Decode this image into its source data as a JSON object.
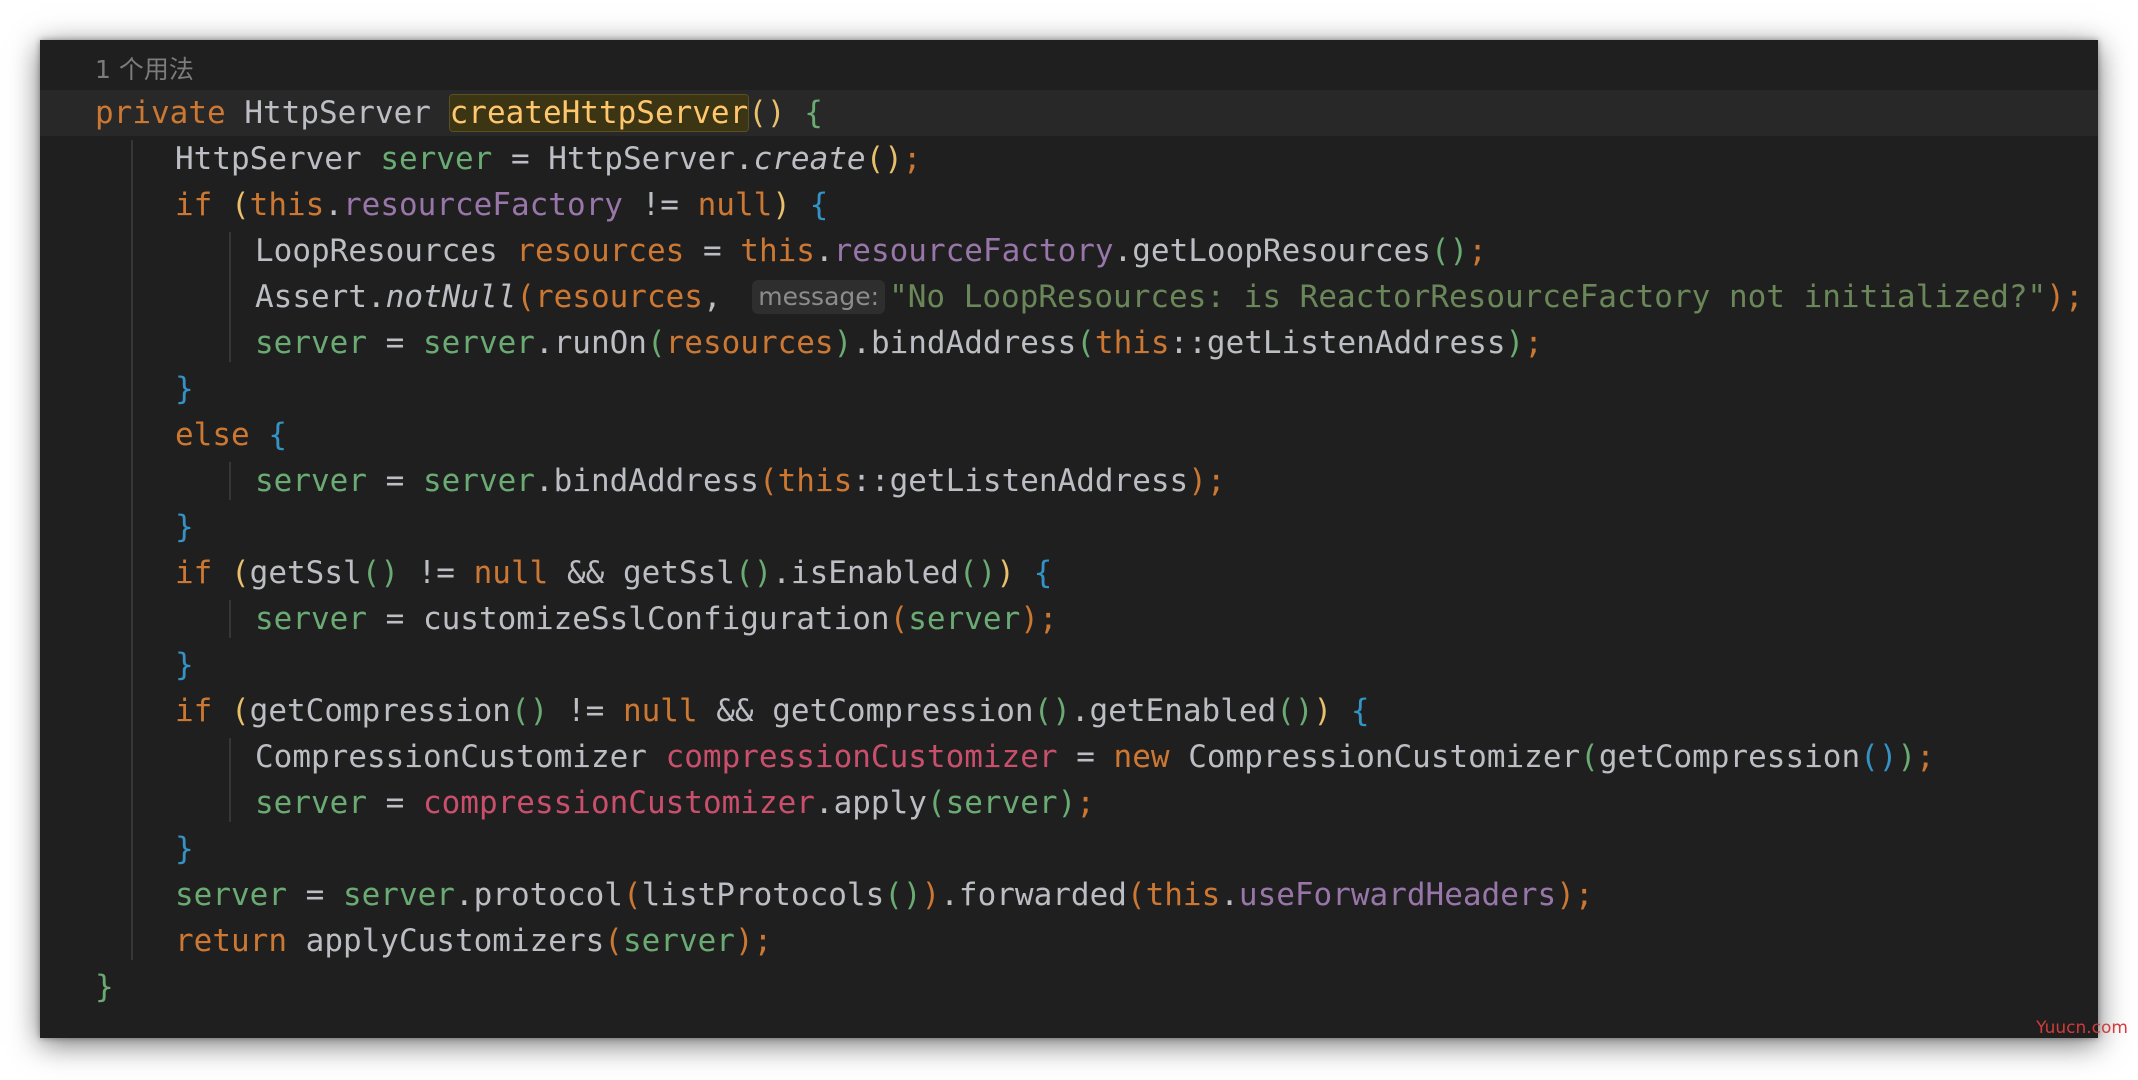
{
  "editor": {
    "usage_hint": "1 个用法",
    "lines": [
      {
        "indent": 0,
        "current": true,
        "tokens": [
          {
            "t": "private",
            "c": "#cc7832"
          },
          {
            "t": " ",
            "c": "#bcbec4"
          },
          {
            "t": "HttpServer",
            "c": "#bcbec4"
          },
          {
            "t": " ",
            "c": "#bcbec4"
          },
          {
            "t": "createHttpServer",
            "c": "#ffc66d",
            "hl": true
          },
          {
            "t": "()",
            "c": "#e8bf6a"
          },
          {
            "t": " ",
            "c": "#bcbec4"
          },
          {
            "t": "{",
            "c": "#6aab73"
          }
        ]
      },
      {
        "indent": 1,
        "tokens": [
          {
            "t": "HttpServer",
            "c": "#bcbec4"
          },
          {
            "t": " ",
            "c": "#bcbec4"
          },
          {
            "t": "server",
            "c": "#6aab73"
          },
          {
            "t": " = ",
            "c": "#bcbec4"
          },
          {
            "t": "HttpServer.",
            "c": "#bcbec4"
          },
          {
            "t": "create",
            "c": "#bcbec4",
            "i": true
          },
          {
            "t": "()",
            "c": "#e8bf6a"
          },
          {
            "t": ";",
            "c": "#cc7832"
          }
        ]
      },
      {
        "indent": 1,
        "tokens": [
          {
            "t": "if",
            "c": "#cc7832"
          },
          {
            "t": " ",
            "c": "#bcbec4"
          },
          {
            "t": "(",
            "c": "#e8bf6a"
          },
          {
            "t": "this",
            "c": "#cc7832"
          },
          {
            "t": ".",
            "c": "#bcbec4"
          },
          {
            "t": "resourceFactory",
            "c": "#9876aa"
          },
          {
            "t": " != ",
            "c": "#bcbec4"
          },
          {
            "t": "null",
            "c": "#cc7832"
          },
          {
            "t": ")",
            "c": "#e8bf6a"
          },
          {
            "t": " ",
            "c": "#bcbec4"
          },
          {
            "t": "{",
            "c": "#3592c4"
          }
        ]
      },
      {
        "indent": 2,
        "tokens": [
          {
            "t": "LoopResources",
            "c": "#bcbec4"
          },
          {
            "t": " ",
            "c": "#bcbec4"
          },
          {
            "t": "resources",
            "c": "#cc7832"
          },
          {
            "t": " = ",
            "c": "#bcbec4"
          },
          {
            "t": "this",
            "c": "#cc7832"
          },
          {
            "t": ".",
            "c": "#bcbec4"
          },
          {
            "t": "resourceFactory",
            "c": "#9876aa"
          },
          {
            "t": ".getLoopResources",
            "c": "#bcbec4"
          },
          {
            "t": "()",
            "c": "#6aab73"
          },
          {
            "t": ";",
            "c": "#cc7832"
          }
        ]
      },
      {
        "indent": 2,
        "tokens": [
          {
            "t": "Assert.",
            "c": "#bcbec4"
          },
          {
            "t": "notNull",
            "c": "#bcbec4",
            "i": true
          },
          {
            "t": "(",
            "c": "#cc7832"
          },
          {
            "t": "resources",
            "c": "#cc7832"
          },
          {
            "t": ", ",
            "c": "#bcbec4"
          },
          {
            "t": "message:",
            "inlay": true
          },
          {
            "t": "\"No LoopResources: is ReactorResourceFactory not initialized?\"",
            "c": "#6a8759"
          },
          {
            "t": ")",
            "c": "#cc7832"
          },
          {
            "t": ";",
            "c": "#cc7832"
          }
        ]
      },
      {
        "indent": 2,
        "tokens": [
          {
            "t": "server",
            "c": "#6aab73"
          },
          {
            "t": " = ",
            "c": "#bcbec4"
          },
          {
            "t": "server",
            "c": "#6aab73"
          },
          {
            "t": ".runOn",
            "c": "#bcbec4"
          },
          {
            "t": "(",
            "c": "#6aab73"
          },
          {
            "t": "resources",
            "c": "#cc7832"
          },
          {
            "t": ")",
            "c": "#6aab73"
          },
          {
            "t": ".bindAddress",
            "c": "#bcbec4"
          },
          {
            "t": "(",
            "c": "#6aab73"
          },
          {
            "t": "this",
            "c": "#cc7832"
          },
          {
            "t": "::getListenAddress",
            "c": "#bcbec4"
          },
          {
            "t": ")",
            "c": "#6aab73"
          },
          {
            "t": ";",
            "c": "#cc7832"
          }
        ]
      },
      {
        "indent": 1,
        "tokens": [
          {
            "t": "}",
            "c": "#3592c4"
          }
        ]
      },
      {
        "indent": 1,
        "tokens": [
          {
            "t": "else",
            "c": "#cc7832"
          },
          {
            "t": " ",
            "c": "#bcbec4"
          },
          {
            "t": "{",
            "c": "#3592c4"
          }
        ]
      },
      {
        "indent": 2,
        "tokens": [
          {
            "t": "server",
            "c": "#6aab73"
          },
          {
            "t": " = ",
            "c": "#bcbec4"
          },
          {
            "t": "server",
            "c": "#6aab73"
          },
          {
            "t": ".bindAddress",
            "c": "#bcbec4"
          },
          {
            "t": "(",
            "c": "#cc7832"
          },
          {
            "t": "this",
            "c": "#cc7832"
          },
          {
            "t": "::getListenAddress",
            "c": "#bcbec4"
          },
          {
            "t": ")",
            "c": "#cc7832"
          },
          {
            "t": ";",
            "c": "#cc7832"
          }
        ]
      },
      {
        "indent": 1,
        "tokens": [
          {
            "t": "}",
            "c": "#3592c4"
          }
        ]
      },
      {
        "indent": 1,
        "tokens": [
          {
            "t": "if",
            "c": "#cc7832"
          },
          {
            "t": " ",
            "c": "#bcbec4"
          },
          {
            "t": "(",
            "c": "#e8bf6a"
          },
          {
            "t": "getSsl",
            "c": "#bcbec4"
          },
          {
            "t": "()",
            "c": "#6aab73"
          },
          {
            "t": " != ",
            "c": "#bcbec4"
          },
          {
            "t": "null",
            "c": "#cc7832"
          },
          {
            "t": " && ",
            "c": "#bcbec4"
          },
          {
            "t": "getSsl",
            "c": "#bcbec4"
          },
          {
            "t": "()",
            "c": "#6aab73"
          },
          {
            "t": ".isEnabled",
            "c": "#bcbec4"
          },
          {
            "t": "()",
            "c": "#6aab73"
          },
          {
            "t": ")",
            "c": "#e8bf6a"
          },
          {
            "t": " ",
            "c": "#bcbec4"
          },
          {
            "t": "{",
            "c": "#3592c4"
          }
        ]
      },
      {
        "indent": 2,
        "tokens": [
          {
            "t": "server",
            "c": "#6aab73"
          },
          {
            "t": " = ",
            "c": "#bcbec4"
          },
          {
            "t": "customizeSslConfiguration",
            "c": "#bcbec4"
          },
          {
            "t": "(",
            "c": "#cc7832"
          },
          {
            "t": "server",
            "c": "#6aab73"
          },
          {
            "t": ")",
            "c": "#cc7832"
          },
          {
            "t": ";",
            "c": "#cc7832"
          }
        ]
      },
      {
        "indent": 1,
        "tokens": [
          {
            "t": "}",
            "c": "#3592c4"
          }
        ]
      },
      {
        "indent": 1,
        "tokens": [
          {
            "t": "if",
            "c": "#cc7832"
          },
          {
            "t": " ",
            "c": "#bcbec4"
          },
          {
            "t": "(",
            "c": "#e8bf6a"
          },
          {
            "t": "getCompression",
            "c": "#bcbec4"
          },
          {
            "t": "()",
            "c": "#6aab73"
          },
          {
            "t": " != ",
            "c": "#bcbec4"
          },
          {
            "t": "null",
            "c": "#cc7832"
          },
          {
            "t": " && ",
            "c": "#bcbec4"
          },
          {
            "t": "getCompression",
            "c": "#bcbec4"
          },
          {
            "t": "()",
            "c": "#6aab73"
          },
          {
            "t": ".getEnabled",
            "c": "#bcbec4"
          },
          {
            "t": "()",
            "c": "#6aab73"
          },
          {
            "t": ")",
            "c": "#e8bf6a"
          },
          {
            "t": " ",
            "c": "#bcbec4"
          },
          {
            "t": "{",
            "c": "#3592c4"
          }
        ]
      },
      {
        "indent": 2,
        "tokens": [
          {
            "t": "CompressionCustomizer",
            "c": "#bcbec4"
          },
          {
            "t": " ",
            "c": "#bcbec4"
          },
          {
            "t": "compressionCustomizer",
            "c": "#c94f6d"
          },
          {
            "t": " = ",
            "c": "#bcbec4"
          },
          {
            "t": "new",
            "c": "#cc7832"
          },
          {
            "t": " ",
            "c": "#bcbec4"
          },
          {
            "t": "CompressionCustomizer",
            "c": "#bcbec4"
          },
          {
            "t": "(",
            "c": "#6aab73"
          },
          {
            "t": "getCompression",
            "c": "#bcbec4"
          },
          {
            "t": "()",
            "c": "#3592c4"
          },
          {
            "t": ")",
            "c": "#6aab73"
          },
          {
            "t": ";",
            "c": "#cc7832"
          }
        ]
      },
      {
        "indent": 2,
        "tokens": [
          {
            "t": "server",
            "c": "#6aab73"
          },
          {
            "t": " = ",
            "c": "#bcbec4"
          },
          {
            "t": "compressionCustomizer",
            "c": "#c94f6d"
          },
          {
            "t": ".apply",
            "c": "#bcbec4"
          },
          {
            "t": "(",
            "c": "#6aab73"
          },
          {
            "t": "server",
            "c": "#6aab73"
          },
          {
            "t": ")",
            "c": "#6aab73"
          },
          {
            "t": ";",
            "c": "#cc7832"
          }
        ]
      },
      {
        "indent": 1,
        "tokens": [
          {
            "t": "}",
            "c": "#3592c4"
          }
        ]
      },
      {
        "indent": 1,
        "tokens": [
          {
            "t": "server",
            "c": "#6aab73"
          },
          {
            "t": " = ",
            "c": "#bcbec4"
          },
          {
            "t": "server",
            "c": "#6aab73"
          },
          {
            "t": ".protocol",
            "c": "#bcbec4"
          },
          {
            "t": "(",
            "c": "#cc7832"
          },
          {
            "t": "listProtocols",
            "c": "#bcbec4"
          },
          {
            "t": "()",
            "c": "#6aab73"
          },
          {
            "t": ")",
            "c": "#cc7832"
          },
          {
            "t": ".forwarded",
            "c": "#bcbec4"
          },
          {
            "t": "(",
            "c": "#cc7832"
          },
          {
            "t": "this",
            "c": "#cc7832"
          },
          {
            "t": ".",
            "c": "#bcbec4"
          },
          {
            "t": "useForwardHeaders",
            "c": "#9876aa"
          },
          {
            "t": ")",
            "c": "#cc7832"
          },
          {
            "t": ";",
            "c": "#cc7832"
          }
        ]
      },
      {
        "indent": 1,
        "tokens": [
          {
            "t": "return",
            "c": "#cc7832"
          },
          {
            "t": " ",
            "c": "#bcbec4"
          },
          {
            "t": "applyCustomizers",
            "c": "#bcbec4"
          },
          {
            "t": "(",
            "c": "#cc7832"
          },
          {
            "t": "server",
            "c": "#6aab73"
          },
          {
            "t": ")",
            "c": "#cc7832"
          },
          {
            "t": ";",
            "c": "#cc7832"
          }
        ]
      },
      {
        "indent": 0,
        "tokens": [
          {
            "t": "}",
            "c": "#6aab73"
          }
        ]
      }
    ]
  },
  "watermark": "Yuucn.com"
}
